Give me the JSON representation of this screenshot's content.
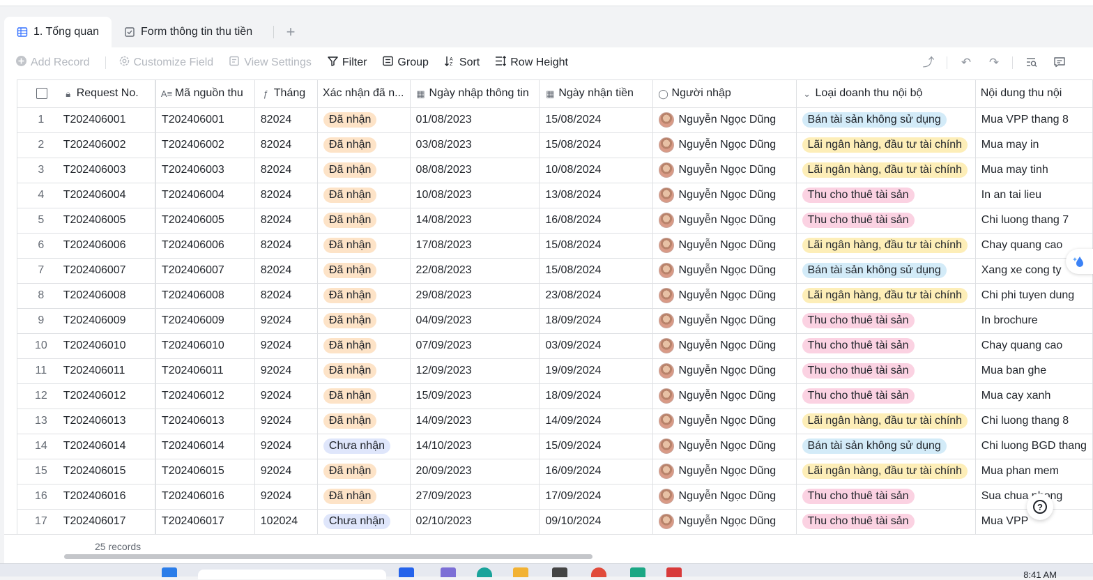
{
  "tabs": [
    {
      "label": "1. Tổng quan",
      "icon": "grid-icon",
      "active": true
    },
    {
      "label": "Form thông tin thu tiền",
      "icon": "form-icon",
      "active": false
    }
  ],
  "toolbar": {
    "add_record": "Add Record",
    "customize_field": "Customize Field",
    "view_settings": "View Settings",
    "filter": "Filter",
    "group": "Group",
    "sort": "Sort",
    "row_height": "Row Height"
  },
  "columns": [
    {
      "key": "request_no",
      "label": "Request No.",
      "icon": "lock-icon"
    },
    {
      "key": "ma_nguon_thu",
      "label": "Mã nguồn thu",
      "icon": "text-icon"
    },
    {
      "key": "thang",
      "label": "Tháng",
      "icon": "formula-icon"
    },
    {
      "key": "xac_nhan",
      "label": "Xác nhận đã n...",
      "icon": "single-select-icon"
    },
    {
      "key": "ngay_nhap",
      "label": "Ngày nhập thông tin",
      "icon": "calendar-icon"
    },
    {
      "key": "ngay_nhan",
      "label": "Ngày nhận tiền",
      "icon": "calendar-icon"
    },
    {
      "key": "nguoi_nhap",
      "label": "Người nhập",
      "icon": "person-icon"
    },
    {
      "key": "loai",
      "label": "Loại doanh thu nội bộ",
      "icon": "dropdown-icon"
    },
    {
      "key": "noi_dung",
      "label": "Nội dung thu nội",
      "icon": "text-icon"
    }
  ],
  "tag_colors": {
    "Đã nhận": "#fde3c7",
    "Chưa nhận": "#dfe6fb",
    "Bán tài sản không sử dụng": "#d3ebf8",
    "Lãi ngân hàng, đầu tư tài chính": "#fdeeb8",
    "Thu cho thuê tài sản": "#fbd2e2"
  },
  "rows": [
    {
      "n": "1",
      "request_no": "T202406001",
      "ma_nguon_thu": "T202406001",
      "thang": "82024",
      "xac_nhan": "Đã nhận",
      "ngay_nhap": "01/08/2023",
      "ngay_nhan": "15/08/2024",
      "nguoi_nhap": "Nguyễn Ngọc Dũng",
      "loai": "Bán tài sản không sử dụng",
      "noi_dung": "Mua VPP thang 8"
    },
    {
      "n": "2",
      "request_no": "T202406002",
      "ma_nguon_thu": "T202406002",
      "thang": "82024",
      "xac_nhan": "Đã nhận",
      "ngay_nhap": "03/08/2023",
      "ngay_nhan": "15/08/2024",
      "nguoi_nhap": "Nguyễn Ngọc Dũng",
      "loai": "Lãi ngân hàng, đầu tư tài chính",
      "noi_dung": "Mua may in"
    },
    {
      "n": "3",
      "request_no": "T202406003",
      "ma_nguon_thu": "T202406003",
      "thang": "82024",
      "xac_nhan": "Đã nhận",
      "ngay_nhap": "08/08/2023",
      "ngay_nhan": "10/08/2024",
      "nguoi_nhap": "Nguyễn Ngọc Dũng",
      "loai": "Lãi ngân hàng, đầu tư tài chính",
      "noi_dung": "Mua may tinh"
    },
    {
      "n": "4",
      "request_no": "T202406004",
      "ma_nguon_thu": "T202406004",
      "thang": "82024",
      "xac_nhan": "Đã nhận",
      "ngay_nhap": "10/08/2023",
      "ngay_nhan": "13/08/2024",
      "nguoi_nhap": "Nguyễn Ngọc Dũng",
      "loai": "Thu cho thuê tài sản",
      "noi_dung": "In an tai lieu"
    },
    {
      "n": "5",
      "request_no": "T202406005",
      "ma_nguon_thu": "T202406005",
      "thang": "82024",
      "xac_nhan": "Đã nhận",
      "ngay_nhap": "14/08/2023",
      "ngay_nhan": "16/08/2024",
      "nguoi_nhap": "Nguyễn Ngọc Dũng",
      "loai": "Thu cho thuê tài sản",
      "noi_dung": "Chi luong thang 7"
    },
    {
      "n": "6",
      "request_no": "T202406006",
      "ma_nguon_thu": "T202406006",
      "thang": "82024",
      "xac_nhan": "Đã nhận",
      "ngay_nhap": "17/08/2023",
      "ngay_nhan": "15/08/2024",
      "nguoi_nhap": "Nguyễn Ngọc Dũng",
      "loai": "Lãi ngân hàng, đầu tư tài chính",
      "noi_dung": "Chay quang cao"
    },
    {
      "n": "7",
      "request_no": "T202406007",
      "ma_nguon_thu": "T202406007",
      "thang": "82024",
      "xac_nhan": "Đã nhận",
      "ngay_nhap": "22/08/2023",
      "ngay_nhan": "15/08/2024",
      "nguoi_nhap": "Nguyễn Ngọc Dũng",
      "loai": "Bán tài sản không sử dụng",
      "noi_dung": "Xang xe cong ty"
    },
    {
      "n": "8",
      "request_no": "T202406008",
      "ma_nguon_thu": "T202406008",
      "thang": "82024",
      "xac_nhan": "Đã nhận",
      "ngay_nhap": "29/08/2023",
      "ngay_nhan": "23/08/2024",
      "nguoi_nhap": "Nguyễn Ngọc Dũng",
      "loai": "Lãi ngân hàng, đầu tư tài chính",
      "noi_dung": "Chi phi tuyen dung"
    },
    {
      "n": "9",
      "request_no": "T202406009",
      "ma_nguon_thu": "T202406009",
      "thang": "92024",
      "xac_nhan": "Đã nhận",
      "ngay_nhap": "04/09/2023",
      "ngay_nhan": "18/09/2024",
      "nguoi_nhap": "Nguyễn Ngọc Dũng",
      "loai": "Thu cho thuê tài sản",
      "noi_dung": "In brochure"
    },
    {
      "n": "10",
      "request_no": "T202406010",
      "ma_nguon_thu": "T202406010",
      "thang": "92024",
      "xac_nhan": "Đã nhận",
      "ngay_nhap": "07/09/2023",
      "ngay_nhan": "03/09/2024",
      "nguoi_nhap": "Nguyễn Ngọc Dũng",
      "loai": "Thu cho thuê tài sản",
      "noi_dung": "Chay quang cao"
    },
    {
      "n": "11",
      "request_no": "T202406011",
      "ma_nguon_thu": "T202406011",
      "thang": "92024",
      "xac_nhan": "Đã nhận",
      "ngay_nhap": "12/09/2023",
      "ngay_nhan": "19/09/2024",
      "nguoi_nhap": "Nguyễn Ngọc Dũng",
      "loai": "Thu cho thuê tài sản",
      "noi_dung": "Mua ban ghe"
    },
    {
      "n": "12",
      "request_no": "T202406012",
      "ma_nguon_thu": "T202406012",
      "thang": "92024",
      "xac_nhan": "Đã nhận",
      "ngay_nhap": "15/09/2023",
      "ngay_nhan": "18/09/2024",
      "nguoi_nhap": "Nguyễn Ngọc Dũng",
      "loai": "Thu cho thuê tài sản",
      "noi_dung": "Mua cay xanh"
    },
    {
      "n": "13",
      "request_no": "T202406013",
      "ma_nguon_thu": "T202406013",
      "thang": "92024",
      "xac_nhan": "Đã nhận",
      "ngay_nhap": "14/09/2023",
      "ngay_nhan": "14/09/2024",
      "nguoi_nhap": "Nguyễn Ngọc Dũng",
      "loai": "Lãi ngân hàng, đầu tư tài chính",
      "noi_dung": "Chi luong thang 8"
    },
    {
      "n": "14",
      "request_no": "T202406014",
      "ma_nguon_thu": "T202406014",
      "thang": "92024",
      "xac_nhan": "Chưa nhận",
      "ngay_nhap": "14/10/2023",
      "ngay_nhan": "15/09/2024",
      "nguoi_nhap": "Nguyễn Ngọc Dũng",
      "loai": "Bán tài sản không sử dụng",
      "noi_dung": "Chi luong BGD thang"
    },
    {
      "n": "15",
      "request_no": "T202406015",
      "ma_nguon_thu": "T202406015",
      "thang": "92024",
      "xac_nhan": "Đã nhận",
      "ngay_nhap": "20/09/2023",
      "ngay_nhan": "16/09/2024",
      "nguoi_nhap": "Nguyễn Ngọc Dũng",
      "loai": "Lãi ngân hàng, đầu tư tài chính",
      "noi_dung": "Mua phan mem"
    },
    {
      "n": "16",
      "request_no": "T202406016",
      "ma_nguon_thu": "T202406016",
      "thang": "92024",
      "xac_nhan": "Đã nhận",
      "ngay_nhap": "27/09/2023",
      "ngay_nhan": "17/09/2024",
      "nguoi_nhap": "Nguyễn Ngọc Dũng",
      "loai": "Thu cho thuê tài sản",
      "noi_dung": "Sua chua phong"
    },
    {
      "n": "17",
      "request_no": "T202406017",
      "ma_nguon_thu": "T202406017",
      "thang": "102024",
      "xac_nhan": "Chưa nhận",
      "ngay_nhap": "02/10/2023",
      "ngay_nhan": "09/10/2024",
      "nguoi_nhap": "Nguyễn Ngọc Dũng",
      "loai": "Thu cho thuê tài sản",
      "noi_dung": "Mua VPP"
    }
  ],
  "footer": {
    "records": "25 records"
  },
  "taskbar": {
    "clock": "8:41 AM"
  }
}
